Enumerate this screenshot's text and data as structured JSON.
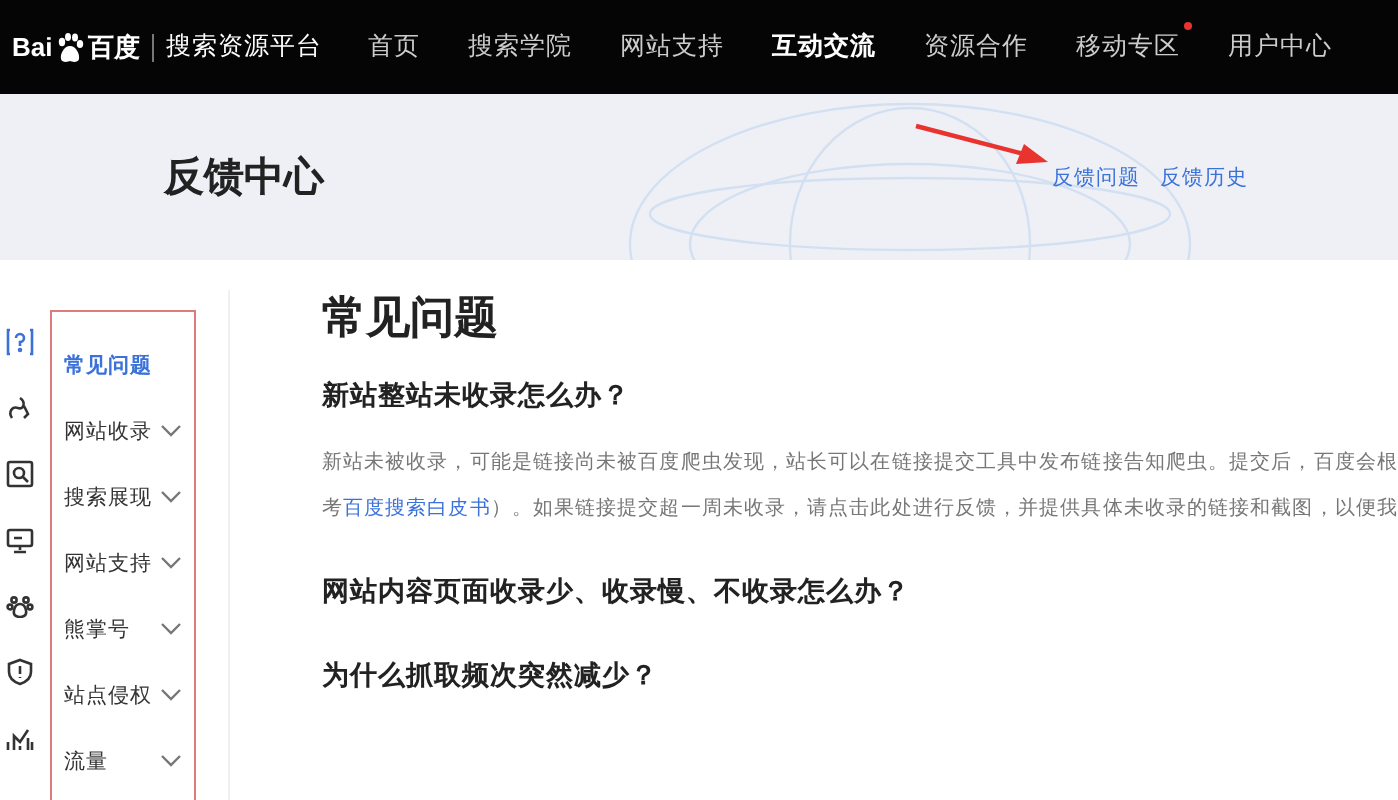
{
  "logo": {
    "brand": "Bai",
    "brand_cn": "百度",
    "platform": "搜索资源平台"
  },
  "nav": [
    {
      "label": "首页",
      "selected": false,
      "badge": false
    },
    {
      "label": "搜索学院",
      "selected": false,
      "badge": false
    },
    {
      "label": "网站支持",
      "selected": false,
      "badge": false
    },
    {
      "label": "互动交流",
      "selected": true,
      "badge": false
    },
    {
      "label": "资源合作",
      "selected": false,
      "badge": false
    },
    {
      "label": "移动专区",
      "selected": false,
      "badge": true
    },
    {
      "label": "用户中心",
      "selected": false,
      "badge": false
    }
  ],
  "banner": {
    "title": "反馈中心",
    "links": [
      {
        "label": "反馈问题"
      },
      {
        "label": "反馈历史"
      }
    ]
  },
  "sidebar": {
    "items": [
      {
        "label": "常见问题",
        "selected": true,
        "expandable": false
      },
      {
        "label": "网站收录",
        "selected": false,
        "expandable": true
      },
      {
        "label": "搜索展现",
        "selected": false,
        "expandable": true
      },
      {
        "label": "网站支持",
        "selected": false,
        "expandable": true
      },
      {
        "label": "熊掌号",
        "selected": false,
        "expandable": true
      },
      {
        "label": "站点侵权",
        "selected": false,
        "expandable": true
      },
      {
        "label": "流量",
        "selected": false,
        "expandable": true
      }
    ]
  },
  "content": {
    "title": "常见问题",
    "questions": [
      {
        "title": "新站整站未收录怎么办？",
        "answer": [
          {
            "text": "新站未被收录，可能是链接尚未被百度爬虫发现，站长可以在链接提交工具中发布链接告知爬虫。提交后，百度会根"
          },
          {
            "text": "考",
            "link": "百度搜索白皮书",
            "after": "）。如果链接提交超一周未收录，请点击此处进行反馈，并提供具体未收录的链接和截图，以便我"
          }
        ]
      },
      {
        "title": "网站内容页面收录少、收录慢、不收录怎么办？"
      },
      {
        "title": "为什么抓取频次突然减少？"
      }
    ]
  }
}
